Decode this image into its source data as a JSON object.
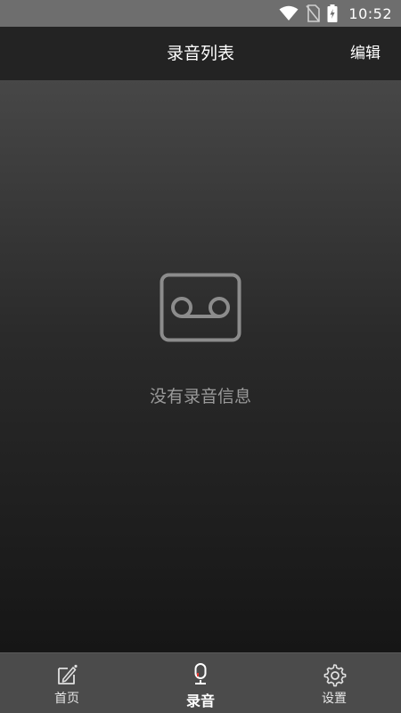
{
  "status_bar": {
    "time": "10:52",
    "icons": [
      "wifi-icon",
      "no-sim-icon",
      "battery-charging-icon"
    ]
  },
  "header": {
    "title": "录音列表",
    "edit_label": "编辑"
  },
  "empty_state": {
    "icon": "cassette-tape-icon",
    "message": "没有录音信息"
  },
  "bottom_nav": {
    "items": [
      {
        "label": "首页",
        "icon": "note-edit-icon",
        "active": false
      },
      {
        "label": "录音",
        "icon": "microphone-icon",
        "active": true
      },
      {
        "label": "设置",
        "icon": "gear-icon",
        "active": false
      }
    ]
  },
  "colors": {
    "status_bar_bg": "#6e6e6e",
    "header_bg": "#232323",
    "nav_bg": "#4b4b4b",
    "empty_text": "#9a9a9a",
    "mic_accent": "#e53935"
  }
}
